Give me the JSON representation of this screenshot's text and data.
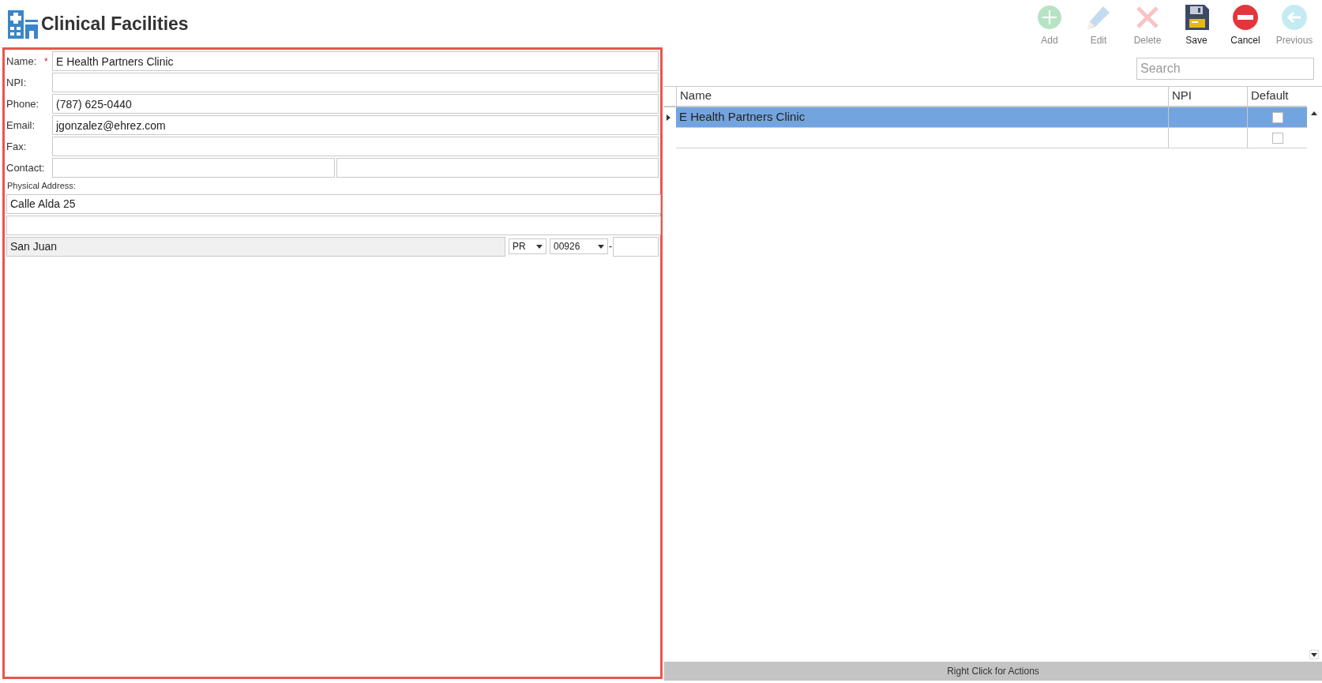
{
  "page_title": "Clinical Facilities",
  "toolbar": [
    {
      "kind": "add",
      "label": "Add",
      "disabled": true
    },
    {
      "kind": "edit",
      "label": "Edit",
      "disabled": true
    },
    {
      "kind": "delete",
      "label": "Delete",
      "disabled": true
    },
    {
      "kind": "save",
      "label": "Save",
      "disabled": false
    },
    {
      "kind": "cancel",
      "label": "Cancel",
      "disabled": false
    },
    {
      "kind": "previous",
      "label": "Previous",
      "disabled": true
    }
  ],
  "form": {
    "fields": [
      {
        "label": "Name:",
        "required_mark": "*",
        "value": "E Health Partners Clinic"
      },
      {
        "label": "NPI:"
      },
      {
        "label": "Phone:",
        "value": "(787) 625-0440"
      },
      {
        "label": "Email:",
        "value": "jgonzalez@ehrez.com"
      },
      {
        "label": "Fax:"
      }
    ],
    "contact": {
      "label": "Contact:"
    },
    "physical_address": {
      "label": "Physical Address:",
      "line1": "Calle Alda 25",
      "city": "San Juan",
      "state": "PR",
      "zip": "00926",
      "zip_separator": "-"
    }
  },
  "search": {
    "placeholder": "Search"
  },
  "table": {
    "columns": [
      "Name",
      "NPI",
      "Default"
    ],
    "rows": [
      {
        "name": "E Health Partners Clinic",
        "selected": true,
        "default": false,
        "current": true
      },
      {
        "selected": false,
        "default": false,
        "current": false
      }
    ]
  },
  "status_bar": "Right Click for Actions"
}
